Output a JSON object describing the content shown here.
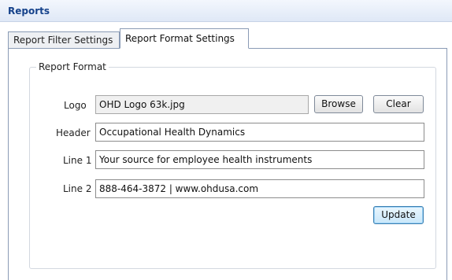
{
  "panel": {
    "title": "Reports"
  },
  "tabs": [
    {
      "label": "Report Filter Settings",
      "active": false
    },
    {
      "label": "Report Format Settings",
      "active": true
    }
  ],
  "report_format": {
    "legend": "Report Format",
    "fields": {
      "logo": {
        "label": "Logo",
        "value": "OHD Logo  63k.jpg"
      },
      "header": {
        "label": "Header",
        "value": "Occupational Health Dynamics"
      },
      "line1": {
        "label": "Line 1",
        "value": "Your source for employee health instruments"
      },
      "line2": {
        "label": "Line 2",
        "value": "888-464-3872 | www.ohdusa.com"
      }
    },
    "buttons": {
      "browse": "Browse",
      "clear": "Clear",
      "update": "Update"
    }
  },
  "colors": {
    "title": "#15428b",
    "tab_border": "#8a9bb5",
    "focus_border": "#3c7fb1"
  }
}
